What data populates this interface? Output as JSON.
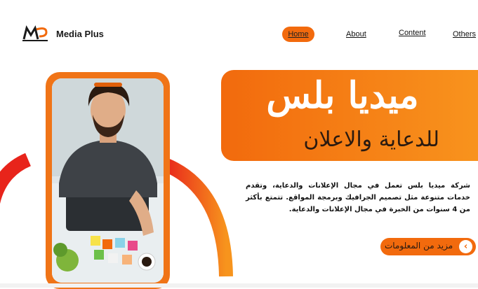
{
  "brand": {
    "logo_text": "Media Plus",
    "accent": "#f26a0d",
    "accent_light": "#f8931d",
    "dark": "#1a1a1a"
  },
  "nav": {
    "items": [
      {
        "label": "Home",
        "active": true
      },
      {
        "label": "About"
      },
      {
        "label": "Content"
      },
      {
        "label": "Others"
      }
    ]
  },
  "hero": {
    "title": "ميديا بلس",
    "subtitle": "للدعاية والاعلان",
    "description": "شركة ميديا بلس تعمل في مجال الإعلانات والدعاية، وتقدم خدمات متنوعة مثل تصميم الجرافيك وبرمجة المواقع. تتمتع بأكثر من 4 سنوات من الخبرة في مجال الإعلانات والدعاية.",
    "cta_label": "مزيد من المعلومات",
    "cta_icon": "chevron-left-icon"
  },
  "image": {
    "subject": "designer-at-desk-photo"
  }
}
